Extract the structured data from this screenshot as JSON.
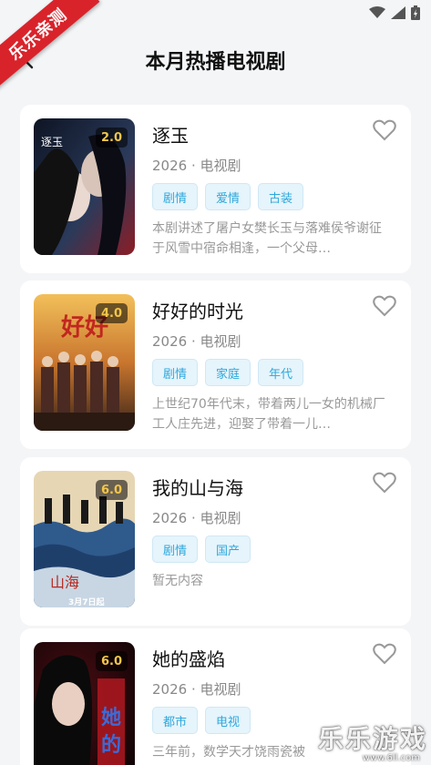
{
  "status": {
    "icons": [
      "wifi-icon",
      "signal-icon",
      "battery-icon"
    ]
  },
  "ribbon": {
    "label": "乐乐亲测"
  },
  "header": {
    "title": "本月热播电视剧"
  },
  "dramas": [
    {
      "title": "逐玉",
      "rating": "2.0",
      "meta": "2026 · 电视剧",
      "tags": [
        "剧情",
        "爱情",
        "古装"
      ],
      "desc": "本剧讲述了屠户女樊长玉与落难侯爷谢征于风雪中宿命相逢，一个父母…",
      "poster_colors": [
        "#1b2233",
        "#5a6b88",
        "#c9d3e6"
      ]
    },
    {
      "title": "好好的时光",
      "rating": "4.0",
      "meta": "2026 · 电视剧",
      "tags": [
        "剧情",
        "家庭",
        "年代"
      ],
      "desc": "上世纪70年代末，带着两儿一女的机械厂工人庄先进，迎娶了带着一儿…",
      "poster_colors": [
        "#f0b84a",
        "#c6452e",
        "#3a2a22"
      ]
    },
    {
      "title": "我的山与海",
      "rating": "6.0",
      "meta": "2026 · 电视剧",
      "tags": [
        "剧情",
        "国产"
      ],
      "desc": "暂无内容",
      "poster_caption": "3月7日起",
      "poster_colors": [
        "#e8d9b8",
        "#2a4d7a",
        "#b9c9d8"
      ]
    },
    {
      "title": "她的盛焰",
      "rating": "6.0",
      "meta": "2026 · 电视剧",
      "tags": [
        "都市",
        "电视"
      ],
      "desc": "三年前，数学天才饶雨瓷被",
      "poster_colors": [
        "#1a0a0c",
        "#a8141c",
        "#3a0a10"
      ]
    }
  ],
  "watermark": {
    "main": "乐乐游戏",
    "sub": "www.6ll.com"
  }
}
